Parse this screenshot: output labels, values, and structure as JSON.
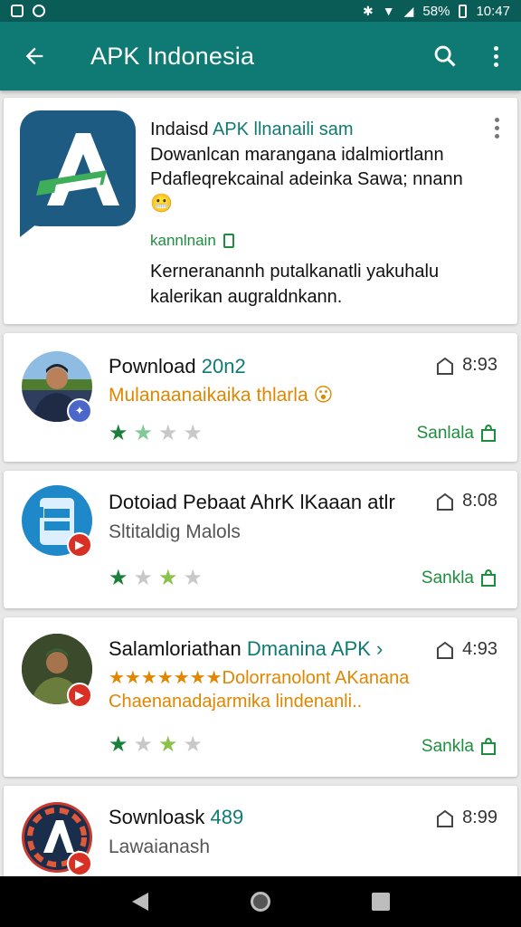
{
  "status_bar": {
    "battery": "58%",
    "time": "10:47"
  },
  "app_bar": {
    "back_icon": "arrow-left-icon",
    "title": "APK Indonesia",
    "search_icon": "search-icon",
    "menu_icon": "more-vert-icon"
  },
  "featured": {
    "title": "Indaisd",
    "title_accent": "APK llnanaili sam",
    "description": "Dowanlcan marangana idalmiortlann Pdafleqrekcainal adeinka Sawa; nnann",
    "emoji": "😬",
    "tag": "kannlnain",
    "body": "Kerneranannh putalkanatli yakuhalu kalerikan augraldnkann."
  },
  "apps": [
    {
      "title": "Pownload",
      "title_accent": "20n2",
      "subtitle": "Mulanaanaikaika thlarla",
      "subtitle_emoji": "😮",
      "price": "8:93",
      "install_label": "Sanlala",
      "rating": 1.5
    },
    {
      "title": "Dotoiad Pebaat AhrK lKaaan atlr",
      "subtitle": "Sltitaldig Malols",
      "price": "8:08",
      "install_label": "Sankla",
      "rating": 2.5
    },
    {
      "title": "Salamloriathan",
      "title_accent": "Dmanina APK",
      "subtitle_stars": "★★★★★★★",
      "subtitle": "Dolorranolont AKanana",
      "subtitle2": "Chaenanadajarmika lindenanli..",
      "price": "4:93",
      "install_label": "Sankla",
      "rating": 2.5
    },
    {
      "title": "Sownloask",
      "title_accent": "489",
      "subtitle": "Lawaianash",
      "price": "8:99"
    }
  ],
  "colors": {
    "status_bar": "#0a5c57",
    "app_bar": "#0f7a73",
    "accent_green": "#1e8e3e",
    "orange": "#e08600",
    "badge_red": "#d93025",
    "badge_blue": "#4a67c9"
  },
  "nav_bar": {
    "back": "nav-back-icon",
    "home": "nav-home-icon",
    "recents": "nav-recents-icon"
  }
}
